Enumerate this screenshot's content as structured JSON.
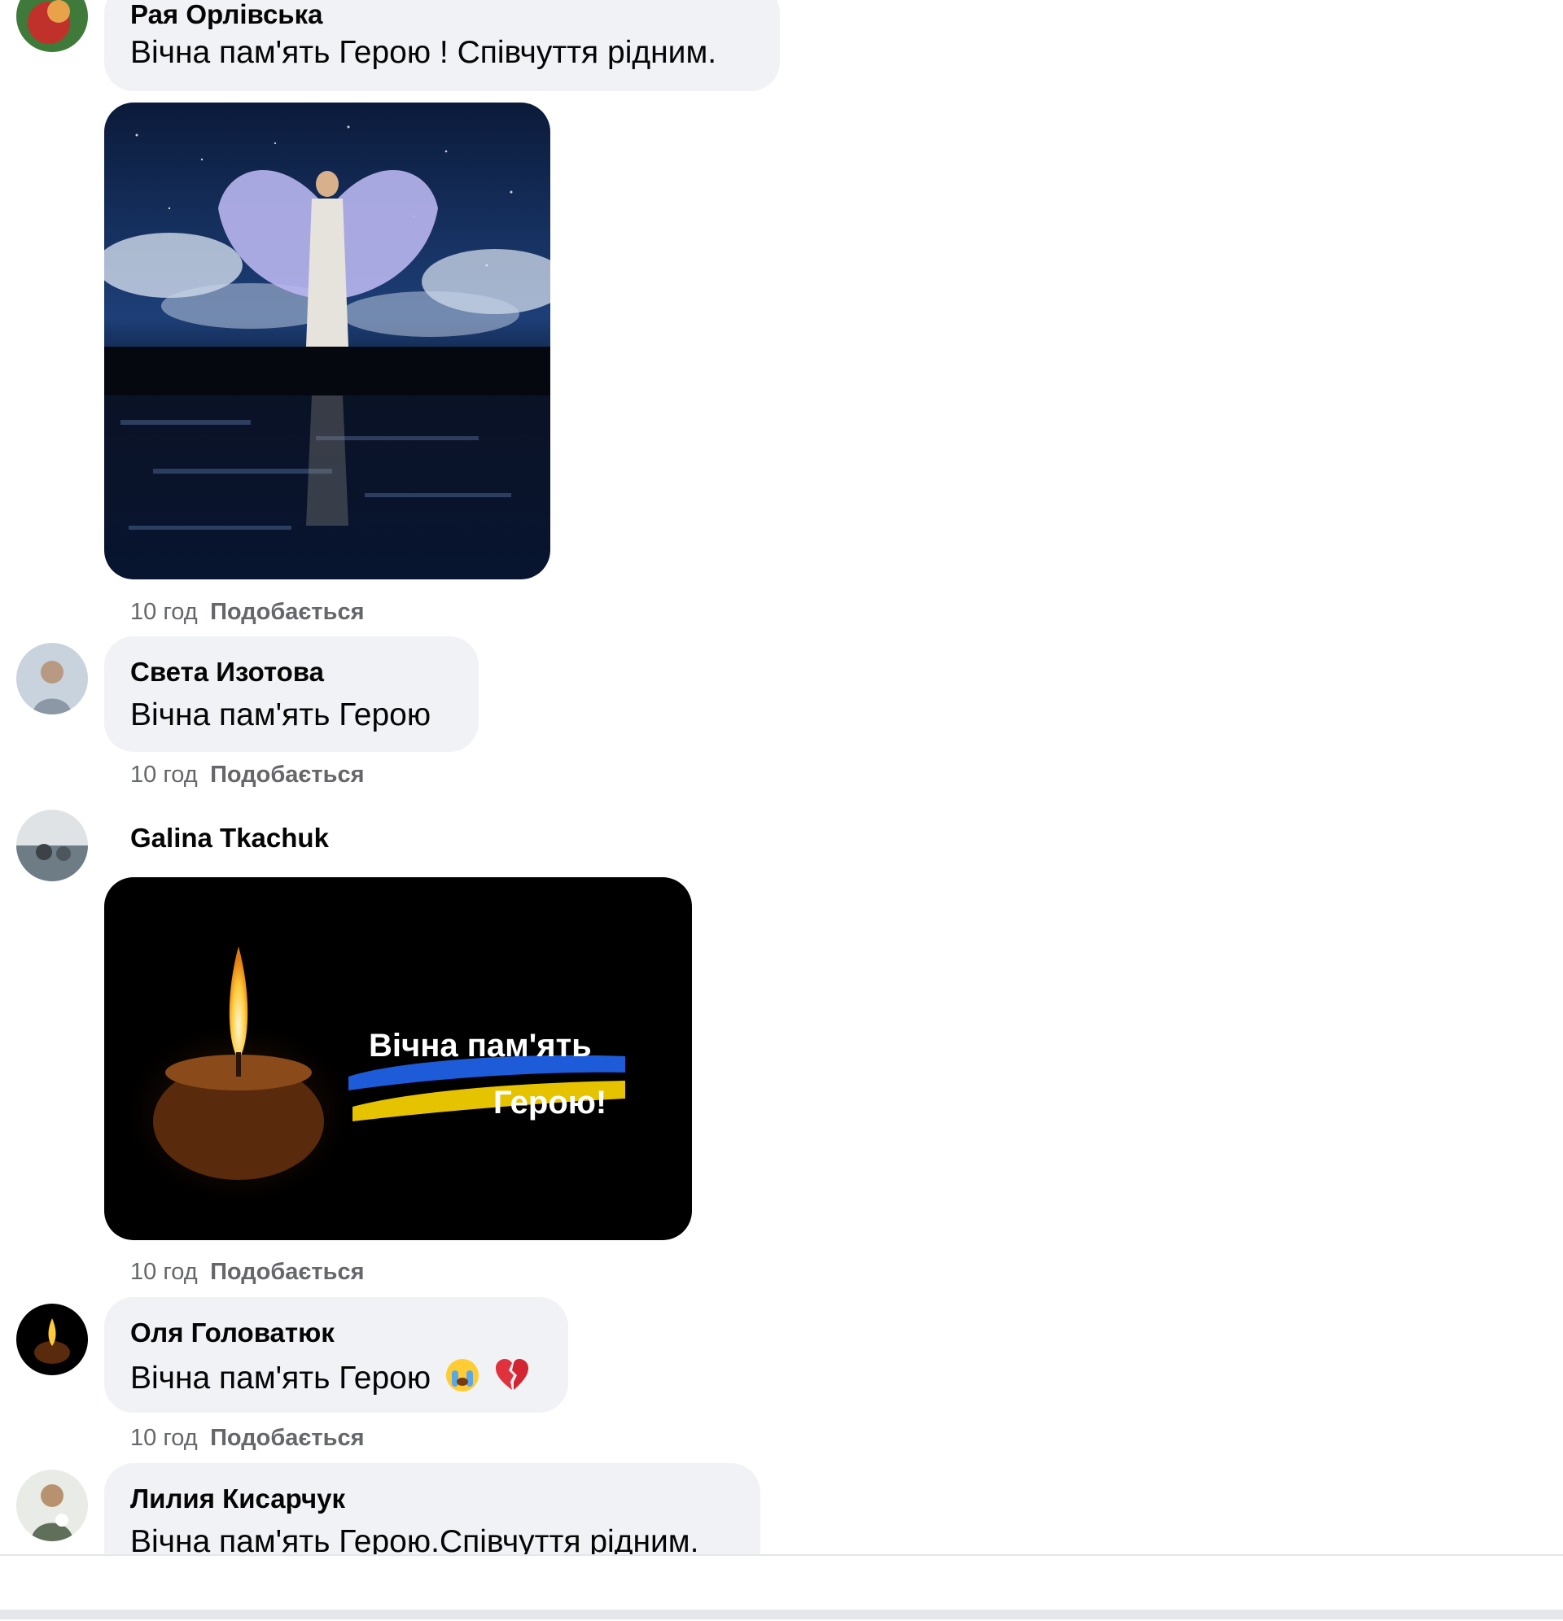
{
  "comments": [
    {
      "author": "Рая Орлівська",
      "text": "Вічна пам'ять Герою ! Співчуття рідним.",
      "image": "angel-image",
      "time": "10 год",
      "like_label": "Подобається"
    },
    {
      "author": "Света Изотова",
      "text": "Вічна пам'ять Герою",
      "time": "10 год",
      "like_label": "Подобається"
    },
    {
      "author": "Galina Tkachuk",
      "image": "candle-image",
      "image_text_line1": "Вічна пам'ять",
      "image_text_line2": "Герою!",
      "time": "10 год",
      "like_label": "Подобається"
    },
    {
      "author": "Оля Головатюк",
      "text": "Вічна пам'ять Герою",
      "emojis": [
        "crying-face-emoji",
        "broken-heart-emoji"
      ],
      "time": "10 год",
      "like_label": "Подобається"
    },
    {
      "author": "Лилия Кисарчук",
      "text": "Вічна пам'ять Герою.Співчуття рідним."
    }
  ],
  "colors": {
    "bubble": "#f0f2f5",
    "meta": "#65676b",
    "text": "#050505",
    "flag_blue": "#1e5bd8",
    "flag_yellow": "#e5c300"
  }
}
